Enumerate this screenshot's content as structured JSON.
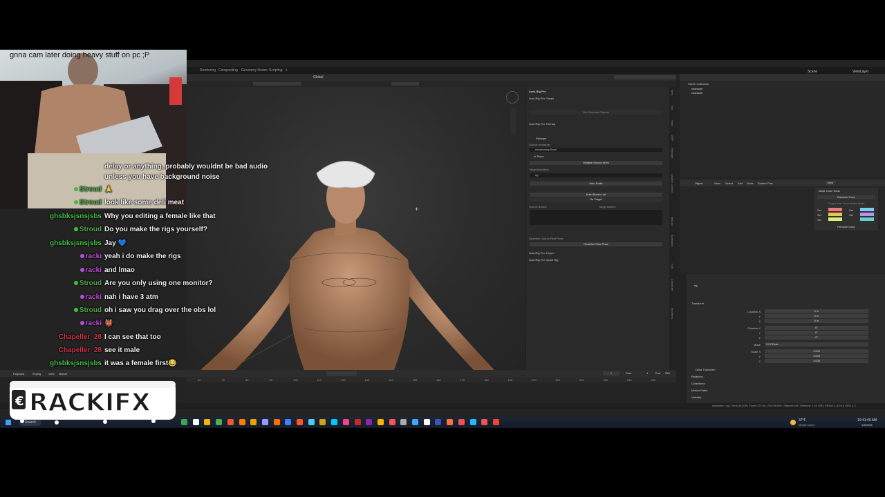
{
  "blender": {
    "workspace_tabs": [
      "Rendering",
      "Compositing",
      "Geometry Nodes",
      "Scripting",
      "+"
    ],
    "viewport_header": {
      "orientation": "Global",
      "options_label": "Options"
    },
    "timeline": {
      "menus": [
        "Playback",
        "Keying",
        "View",
        "Marker"
      ],
      "frame": "1",
      "start_label": "Start",
      "start": "1",
      "end_label": "End",
      "end": "250",
      "ticks": [
        "60",
        "70",
        "80",
        "90",
        "100",
        "110",
        "120",
        "130",
        "140",
        "150",
        "160",
        "170",
        "180",
        "190",
        "200",
        "210",
        "220",
        "230",
        "240",
        "250"
      ]
    },
    "npanel": {
      "title": "Auto-Rig Pro",
      "smart": "Auto-Rig Pro: Smart",
      "get_selected": "Get Selected Objects",
      "remap": "Auto-Rig Pro: Remap",
      "retarget": "Retarget",
      "source_armature_label": "Source Armature:",
      "source_armature": "neosensing-Rose",
      "in_place": "In Place",
      "multiple_source": "Multiple Source Anim",
      "target_armature_label": "Target Armature:",
      "target_armature": "rig",
      "auto_scale": "Auto Scale",
      "build_bones": "Build Bones List",
      "retarget_btn": "Re-Target",
      "source_bones": "Source Bones:",
      "target_bones": "Target Bones:",
      "redefine_pose": "Redefine Source Rest Pose:",
      "redefine_btn": "Redefine Rest Pose",
      "export": "Auto-Rig Pro: Export",
      "quick_rig": "Auto-Rig Pro: Quick Rig"
    },
    "sidetabs": [
      "Item",
      "Tool",
      "View",
      "ARP",
      "Retarget",
      "Launch Control",
      "MBLab",
      "Animation",
      "Edit",
      "Character",
      "Modifiers"
    ],
    "outliner": {
      "title": "Scene Collection",
      "items": [
        "character",
        "character"
      ],
      "scene": "Scene",
      "view_layer": "ViewLayer"
    },
    "shader_editor": {
      "mode": "Object",
      "menus": [
        "View",
        "Select",
        "Add",
        "Node",
        "Shader Plus"
      ],
      "new_label": "New",
      "node_tools": "Node Color Tools",
      "random_color": "Random Color",
      "copy_color": "Copy Color From Active Node",
      "set_labels": [
        "Set",
        "Set",
        "Set",
        "Set",
        "Set"
      ],
      "remove_color": "Remove Color",
      "swatches": [
        "#e87a7a",
        "#f0c060",
        "#d8f070",
        "#7ad0f0",
        "#c090f0",
        "#60d0d0"
      ]
    },
    "properties": {
      "object_name": "rig",
      "transform": "Transform",
      "location_label": "Location X",
      "y_label": "Y",
      "z_label": "Z",
      "location": [
        "0 m",
        "0 m",
        "0 m"
      ],
      "rotation_label": "Rotation X",
      "rotation": [
        "0°",
        "0°",
        "0°"
      ],
      "mode_label": "Mode",
      "mode": "XYZ Euler",
      "scale_label": "Scale X",
      "scale": [
        "1.000",
        "1.000",
        "1.000"
      ],
      "sections": [
        "Delta Transform",
        "Relations",
        "Collections",
        "Motion Paths",
        "Visibility"
      ]
    },
    "statusbar": "character | rig | Verts:34,828 | Faces:33,740 | Tris:58,690 | Objects:0/9 | Memory: 1.46 GiB | VRAM: 1.3/24.0 GiB | 4.2"
  },
  "taskbar": {
    "search": "Search",
    "weather_temp": "37°F",
    "weather_desc": "Mostly sunny",
    "time": "10:41:49 AM",
    "date": "1/4/2026",
    "icon_colors": [
      "#3ba55d",
      "#ffffff",
      "#f5b400",
      "#4caf50",
      "#e85b2b",
      "#ff7c00",
      "#f0a000",
      "#9999ff",
      "#ff6f00",
      "#3b82f6",
      "#ff5722",
      "#4ec9f0",
      "#d4a017",
      "#00c8ff",
      "#ff4081",
      "#c62828",
      "#8e24aa",
      "#ffb300",
      "#ff5252",
      "#aaaaaa",
      "#42a5f5",
      "#ffffff",
      "#3f51b5",
      "#ff7043",
      "#ef5350",
      "#29b6f6",
      "#ef5350",
      "#f44336"
    ]
  },
  "webcam": {
    "caption": "gnna cam later doing heavy stuff on pc ;P"
  },
  "chat": [
    {
      "user": "",
      "user_color": "#ffffff",
      "badge": "",
      "message": "delay or anything, probably wouldnt be bad audio"
    },
    {
      "user": "",
      "user_color": "#ffffff",
      "badge": "",
      "message": "unless you have background noise"
    },
    {
      "user": "Stroud",
      "user_color": "#4ea84a",
      "badge": "#3fbf3f",
      "message": "🙏"
    },
    {
      "user": "Stroud",
      "user_color": "#4ea84a",
      "badge": "#3fbf3f",
      "message": "look like some deli meat"
    },
    {
      "user": "ghsbksjsnsjsbs",
      "user_color": "#3fbf3f",
      "badge": "",
      "message": "Why you editing a female like that"
    },
    {
      "user": "Stroud",
      "user_color": "#4ea84a",
      "badge": "#3fbf3f",
      "message": "Do you make the rigs yourself?"
    },
    {
      "user": "ghsbksjsnsjsbs",
      "user_color": "#3fbf3f",
      "badge": "",
      "message": "Jay 💙"
    },
    {
      "user": "racki",
      "user_color": "#c04ad8",
      "badge": "#b14fd8",
      "message": "yeah i do make the rigs"
    },
    {
      "user": "racki",
      "user_color": "#c04ad8",
      "badge": "#b14fd8",
      "message": "and lmao"
    },
    {
      "user": "Stroud",
      "user_color": "#4ea84a",
      "badge": "#3fbf3f",
      "message": "Are you only using one monitor?"
    },
    {
      "user": "racki",
      "user_color": "#c04ad8",
      "badge": "#b14fd8",
      "message": "nah i have 3 atm"
    },
    {
      "user": "Stroud",
      "user_color": "#4ea84a",
      "badge": "#3fbf3f",
      "message": "oh i saw you drag over the obs lol"
    },
    {
      "user": "racki",
      "user_color": "#c04ad8",
      "badge": "#b14fd8",
      "message": "👹"
    },
    {
      "user": "Chapeller_28",
      "user_color": "#d0304a",
      "badge": "",
      "message": "I can see that too"
    },
    {
      "user": "Chapeller_28",
      "user_color": "#d0304a",
      "badge": "",
      "message": "see it male"
    },
    {
      "user": "ghsbksjsnsjsbs",
      "user_color": "#3fbf3f",
      "badge": "",
      "message": "it was a female first😂"
    }
  ],
  "logo": {
    "text": "RACKIFX"
  }
}
